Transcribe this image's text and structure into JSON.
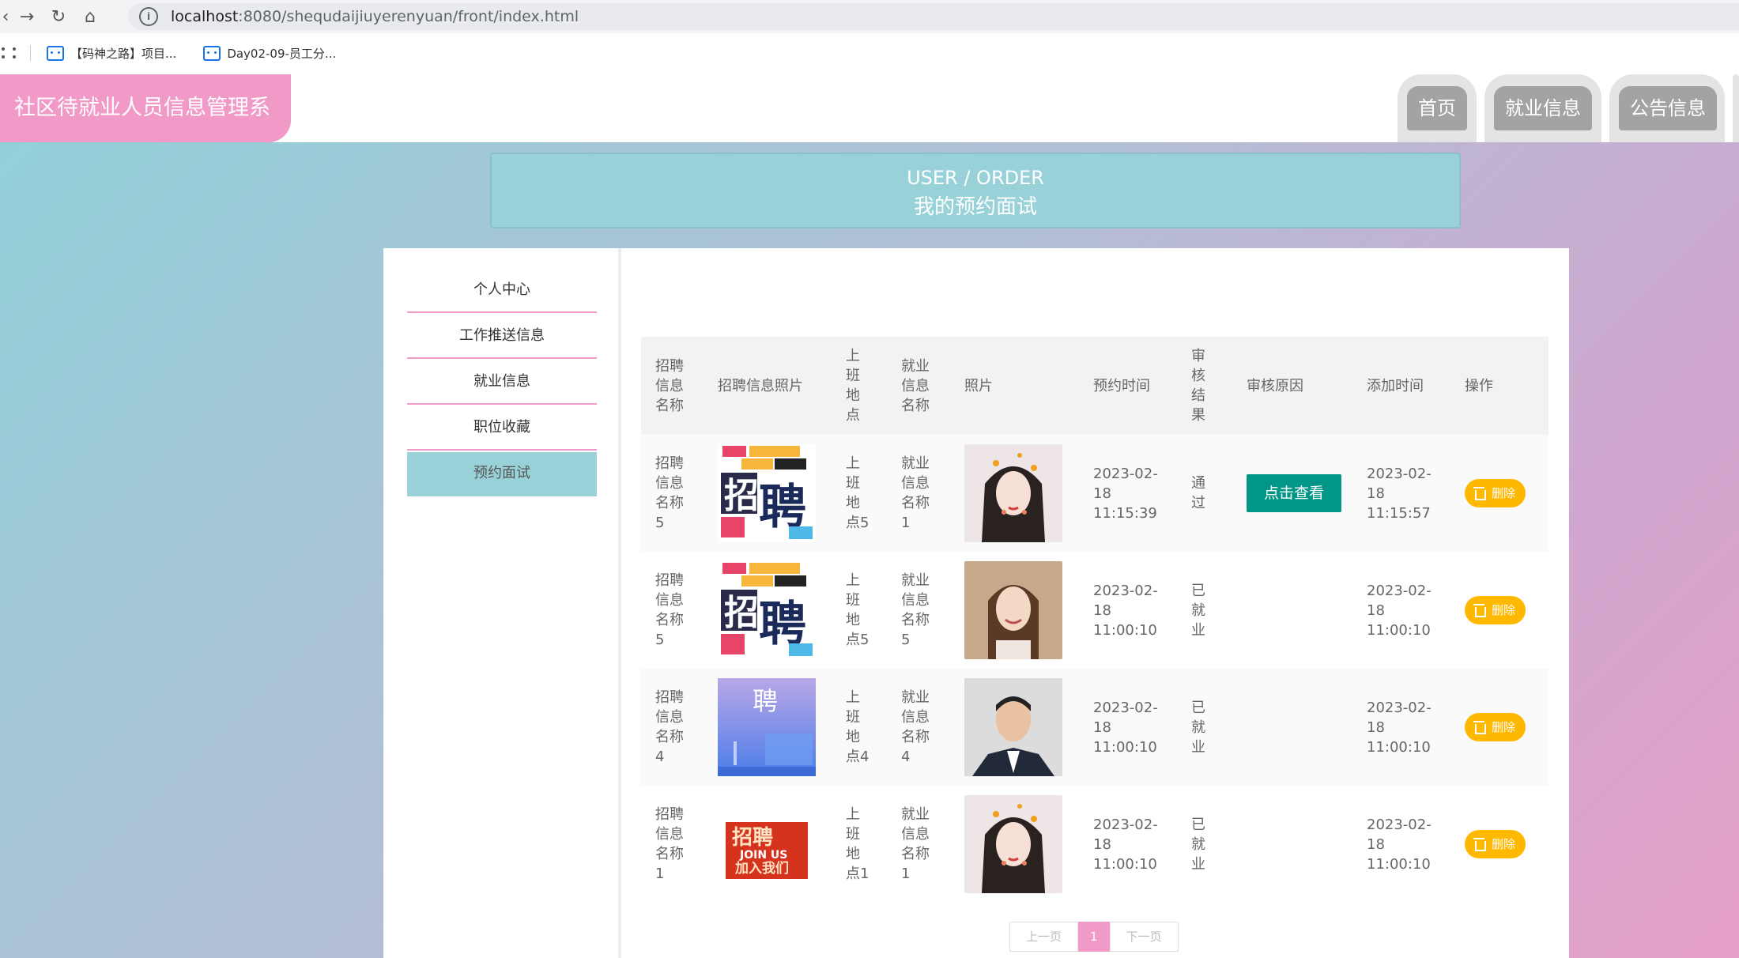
{
  "browser": {
    "url_host": "localhost",
    "url_path": ":8080/shequdaijiuyerenyuan/front/index.html",
    "bookmarks": [
      "【码神之路】项目...",
      "Day02-09-员工分..."
    ]
  },
  "header": {
    "site_title": "社区待就业人员信息管理系统",
    "nav": [
      "首页",
      "就业信息",
      "公告信息"
    ]
  },
  "banner": {
    "en": "USER / ORDER",
    "cn": "我的预约面试"
  },
  "side_menu": {
    "items": [
      "个人中心",
      "工作推送信息",
      "就业信息",
      "职位收藏",
      "预约面试"
    ],
    "active_index": 4
  },
  "table": {
    "headers": [
      "招聘信息名称",
      "招聘信息照片",
      "上班地点",
      "就业信息名称",
      "照片",
      "预约时间",
      "审核结果",
      "审核原因",
      "添加时间",
      "操作"
    ],
    "rows": [
      {
        "name": "招聘信息名称5",
        "poster": "poster-pink-yellow",
        "location": "上班地点5",
        "job": "就业信息名称1",
        "photo": "photo-woman-hearts",
        "appt": "2023-02-18 11:15:39",
        "result": "通过",
        "reason_btn": "点击查看",
        "added": "2023-02-18 11:15:57",
        "delete": "删除"
      },
      {
        "name": "招聘信息名称5",
        "poster": "poster-pink-yellow",
        "location": "上班地点5",
        "job": "就业信息名称5",
        "photo": "photo-woman-smile",
        "appt": "2023-02-18 11:00:10",
        "result": "已就业",
        "reason_btn": "",
        "added": "2023-02-18 11:00:10",
        "delete": "删除"
      },
      {
        "name": "招聘信息名称4",
        "poster": "poster-blue-gradient",
        "location": "上班地点4",
        "job": "就业信息名称4",
        "photo": "photo-man-suit",
        "appt": "2023-02-18 11:00:10",
        "result": "已就业",
        "reason_btn": "",
        "added": "2023-02-18 11:00:10",
        "delete": "删除"
      },
      {
        "name": "招聘信息名称1",
        "poster": "poster-red-3d",
        "location": "上班地点1",
        "job": "就业信息名称1",
        "photo": "photo-woman-hearts",
        "appt": "2023-02-18 11:00:10",
        "result": "已就业",
        "reason_btn": "",
        "added": "2023-02-18 11:00:10",
        "delete": "删除"
      }
    ]
  },
  "poster_texts": {
    "poster-pink-yellow": [
      "招",
      "聘"
    ],
    "poster-blue-gradient": [
      "聘"
    ],
    "poster-red-3d": [
      "招聘",
      "JOIN US",
      "加入我们"
    ]
  },
  "pager": {
    "prev": "上一页",
    "current": "1",
    "next": "下一页"
  },
  "colors": {
    "brand_pink": "#f29ac7",
    "teal": "#98d2d8",
    "view_btn": "#009688",
    "delete_btn": "#ffb800"
  }
}
